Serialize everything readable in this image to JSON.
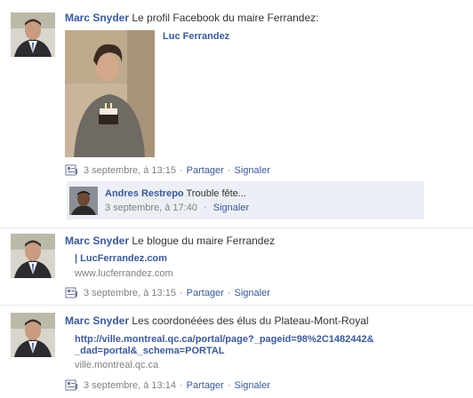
{
  "posts": [
    {
      "author": "Marc Snyder",
      "message": "Le profil Facebook du maire Ferrandez:",
      "attachment_title": "Luc Ferrandez",
      "time": "3 septembre, à 13:15",
      "share": "Partager",
      "report": "Signaler",
      "comment": {
        "author": "Andres Restrepo",
        "text": "Trouble fête...",
        "time": "3 septembre, à 17:40",
        "report": "Signaler"
      }
    },
    {
      "author": "Marc Snyder",
      "message": "Le blogue du maire Ferrandez",
      "attachment_title": "| LucFerrandez.com",
      "attachment_url": "www.lucferrandez.com",
      "time": "3 septembre, à 13:15",
      "share": "Partager",
      "report": "Signaler"
    },
    {
      "author": "Marc Snyder",
      "message": "Les coordonéées des élus du Plateau-Mont-Royal",
      "attachment_title_line1": "http://ville.montreal.qc.ca/portal/page?_pageid=98%2C1482442&",
      "attachment_title_line2": "_dad=portal&_schema=PORTAL",
      "attachment_url": "ville.montreal.qc.ca",
      "time": "3 septembre, à 13:14",
      "share": "Partager",
      "report": "Signaler"
    }
  ],
  "colors": {
    "link": "#3b5998",
    "meta": "#808080",
    "comment_bg": "#eceff5"
  }
}
